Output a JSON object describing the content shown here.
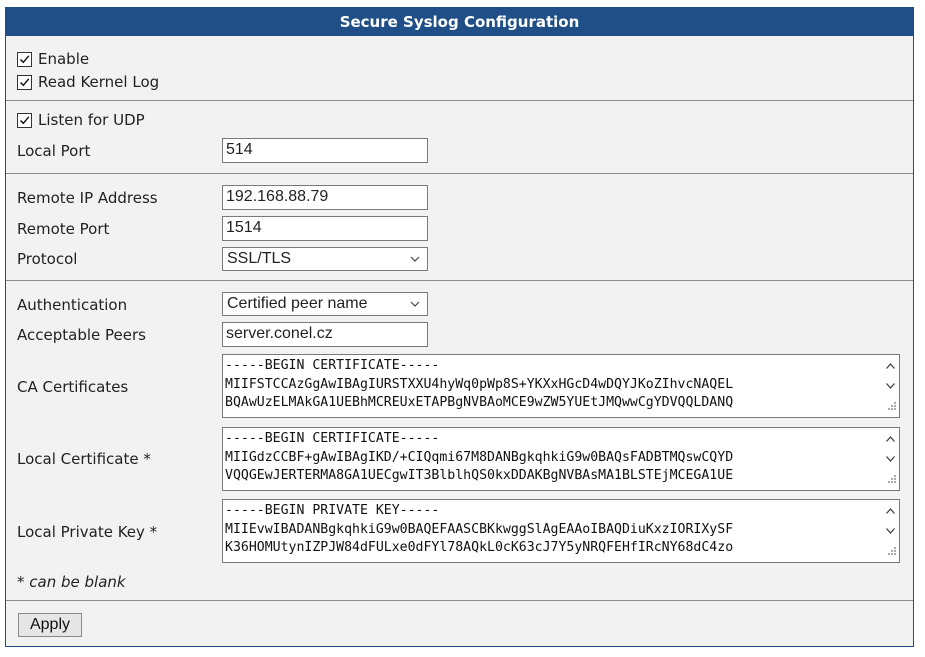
{
  "header": {
    "title": "Secure Syslog Configuration"
  },
  "general": {
    "enable": {
      "label": "Enable",
      "checked": true
    },
    "read_kernel_log": {
      "label": "Read Kernel Log",
      "checked": true
    }
  },
  "udp": {
    "listen": {
      "label": "Listen for UDP",
      "checked": true
    },
    "local_port": {
      "label": "Local Port",
      "value": "514"
    }
  },
  "remote": {
    "ip": {
      "label": "Remote IP Address",
      "value": "192.168.88.79"
    },
    "port": {
      "label": "Remote Port",
      "value": "1514"
    },
    "protocol": {
      "label": "Protocol",
      "value": "SSL/TLS"
    }
  },
  "auth": {
    "authentication": {
      "label": "Authentication",
      "value": "Certified peer name"
    },
    "peers": {
      "label": "Acceptable Peers",
      "value": "server.conel.cz"
    },
    "ca_certificates": {
      "label": "CA Certificates",
      "value": "-----BEGIN CERTIFICATE-----\nMIIFSTCCAzGgAwIBAgIURSTXXU4hyWq0pWp8S+YKXxHGcD4wDQYJKoZIhvcNAQEL\nBQAwUzELMAkGA1UEBhMCREUxETAPBgNVBAoMCE9wZW5YUEtJMQwwCgYDVQQLDANQ"
    },
    "local_certificate": {
      "label": "Local Certificate *",
      "value": "-----BEGIN CERTIFICATE-----\nMIIGdzCCBF+gAwIBAgIKD/+CIQqmi67M8DANBgkqhkiG9w0BAQsFADBTMQswCQYD\nVQQGEwJERTERMA8GA1UECgwIT3BlblhQS0kxDDAKBgNVBAsMA1BLSTEjMCEGA1UE"
    },
    "local_private_key": {
      "label": "Local Private Key *",
      "value": "-----BEGIN PRIVATE KEY-----\nMIIEvwIBADANBgkqhkiG9w0BAQEFAASCBKkwggSlAgEAAoIBAQDiuKxzIORIXySF\nK36HOMUtynIZPJW84dFULxe0dFYl78AQkL0cK63cJ7Y5yNRQFEHfIRcNY68dC4zo"
    },
    "note": "* can be blank"
  },
  "footer": {
    "apply_label": "Apply"
  },
  "colors": {
    "header_bg": "#1f4f86",
    "panel_bg": "#f2f2f2"
  }
}
